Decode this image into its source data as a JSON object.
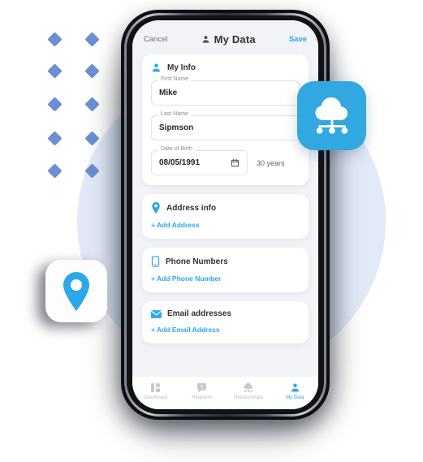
{
  "app": {
    "header": {
      "cancel_label": "Cancel",
      "title": "My Data",
      "save_label": "Save",
      "title_icon": "person-icon"
    }
  },
  "my_info": {
    "title": "My Info",
    "icon": "person-icon",
    "fields": [
      {
        "label": "First Name",
        "value": "Mike"
      },
      {
        "label": "Last Name",
        "value": "Sipmson"
      },
      {
        "label": "Date of Birth",
        "value": "08/05/1991",
        "icon": "calendar-icon"
      }
    ],
    "age_text": "30 years"
  },
  "sections": [
    {
      "title": "Address info",
      "icon": "map-pin-icon",
      "add_label": "+ Add Address"
    },
    {
      "title": "Phone Numbers",
      "icon": "mobile-phone-icon",
      "add_label": "+ Add Phone Number"
    },
    {
      "title": "Email addresses",
      "icon": "envelope-icon",
      "add_label": "+ Add Email Address"
    }
  ],
  "tabs": [
    {
      "label": "Dashboard",
      "icon": "grid-dashboard-icon",
      "active": false
    },
    {
      "label": "Requests",
      "icon": "question-bubble-icon",
      "active": false
    },
    {
      "label": "Relationships",
      "icon": "cloud-network-icon",
      "active": false
    },
    {
      "label": "My Data",
      "icon": "person-icon",
      "active": true
    }
  ],
  "badges": [
    {
      "name": "cloud-network-badge",
      "icon": "cloud-network-icon"
    },
    {
      "name": "location-pin-badge",
      "icon": "map-pin-icon"
    }
  ],
  "colors": {
    "accent": "#2ca7e8",
    "badge_blue": "#31a8e0",
    "circle_blue": "#e2eaf8",
    "diamond_blue": "#6b8fd4",
    "text_dark": "#2f3238",
    "text_muted": "#8a8d94",
    "tab_inactive": "#b9bcc3"
  }
}
